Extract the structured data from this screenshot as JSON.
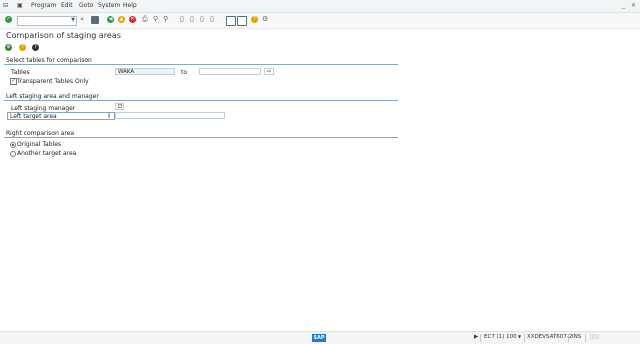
{
  "menu": {
    "items": [
      "Program",
      "Edit",
      "Goto",
      "System",
      "Help"
    ]
  },
  "toolbar": {
    "command_value": ""
  },
  "page": {
    "title": "Comparison of staging areas"
  },
  "group1": {
    "title": "Select tables for comparison",
    "tables_label": "Tables",
    "tables_from": "WAKA",
    "to_label": "to",
    "tables_to": "",
    "transparent_label": "Transparent Tables Only",
    "transparent_checked": true
  },
  "group2": {
    "title": "Left staging area and manager",
    "manager_label": "Left staging manager",
    "manager_value": "D",
    "target_label": "Left target area",
    "target_value": ""
  },
  "group3": {
    "title": "Right comparison area",
    "options": [
      "Original Tables",
      "Another target area"
    ],
    "selected": 0
  },
  "status": {
    "system": "EC7 (1) 100",
    "server": "XXDEVSAT607-2",
    "mode": "INS"
  },
  "colors": {
    "accent_green": "#2e9b3f",
    "help_yellow": "#e6a100",
    "cancel_red": "#d22c2c",
    "group_line": "#8aa6c2"
  }
}
